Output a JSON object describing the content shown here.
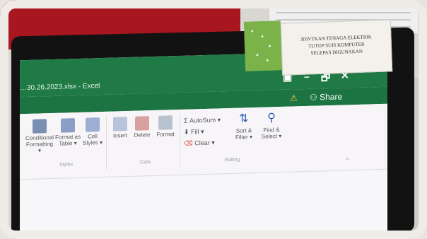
{
  "photo": {
    "subject": "photo of Excel window on a monitor with a sticker label"
  },
  "window": {
    "title": "…30.26.2023.xlsx - Excel",
    "share_label": "Share",
    "controls": [
      "▣",
      "–",
      "🗗",
      "✕"
    ]
  },
  "ribbon": {
    "styles": {
      "conditional": "Conditional Formatting ▾",
      "format_table": "Format as Table ▾",
      "cell_styles": "Cell Styles ▾",
      "group": "Styles"
    },
    "cells": {
      "insert": "Insert",
      "delete": "Delete",
      "format": "Format",
      "group": "Cells"
    },
    "editing": {
      "autosum": "AutoSum ▾",
      "fill": "Fill ▾",
      "clear": "Clear ▾",
      "sort_filter": "Sort & Filter ▾",
      "find_select": "Find & Select ▾",
      "group": "Editing"
    }
  },
  "sticker_text": [
    "JDIVTKAN TENAGA ELEKTRIK",
    "TUTUP SUIS KOMPUTER",
    "SELEPAS DIGUNAKAN"
  ],
  "colors": {
    "excel_green": "#1f7a45",
    "bezel": "#121212",
    "wall_red": "#a8161f",
    "sticker_green": "#7bb24a"
  }
}
